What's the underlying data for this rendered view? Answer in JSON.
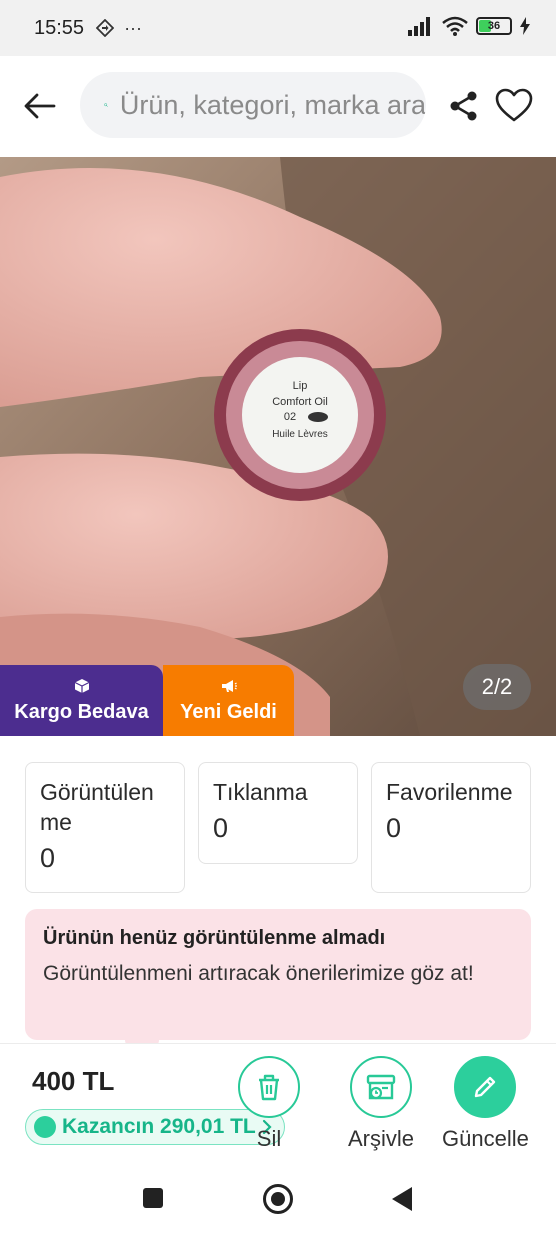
{
  "status_bar": {
    "time": "15:55",
    "battery": "36"
  },
  "search": {
    "placeholder": "Ürün, kategori, marka ara"
  },
  "photo": {
    "pager": "2/2",
    "lid_text": [
      "Lip",
      "Comfort Oil",
      "02",
      "Huile Lèvres"
    ]
  },
  "badges": {
    "cargo": "Kargo Bedava",
    "new": "Yeni Geldi"
  },
  "stats": [
    {
      "label": "Görüntülenme",
      "value": "0"
    },
    {
      "label": "Tıklanma",
      "value": "0"
    },
    {
      "label": "Favorilenme",
      "value": "0"
    }
  ],
  "notice": {
    "title": "Ürünün henüz görüntülenme almadı",
    "body": "Görüntülenmeni artıracak önerilerimize göz at!"
  },
  "bottom": {
    "price": "400 TL",
    "earning": "Kazancın 290,01 TL",
    "actions": {
      "delete": "Sil",
      "archive": "Arşivle",
      "update": "Güncelle"
    }
  },
  "colors": {
    "accent": "#2ccf9c",
    "cargo_badge": "#4c2d8f",
    "new_badge": "#f77c00",
    "notice_bg": "#fbe2e7"
  }
}
